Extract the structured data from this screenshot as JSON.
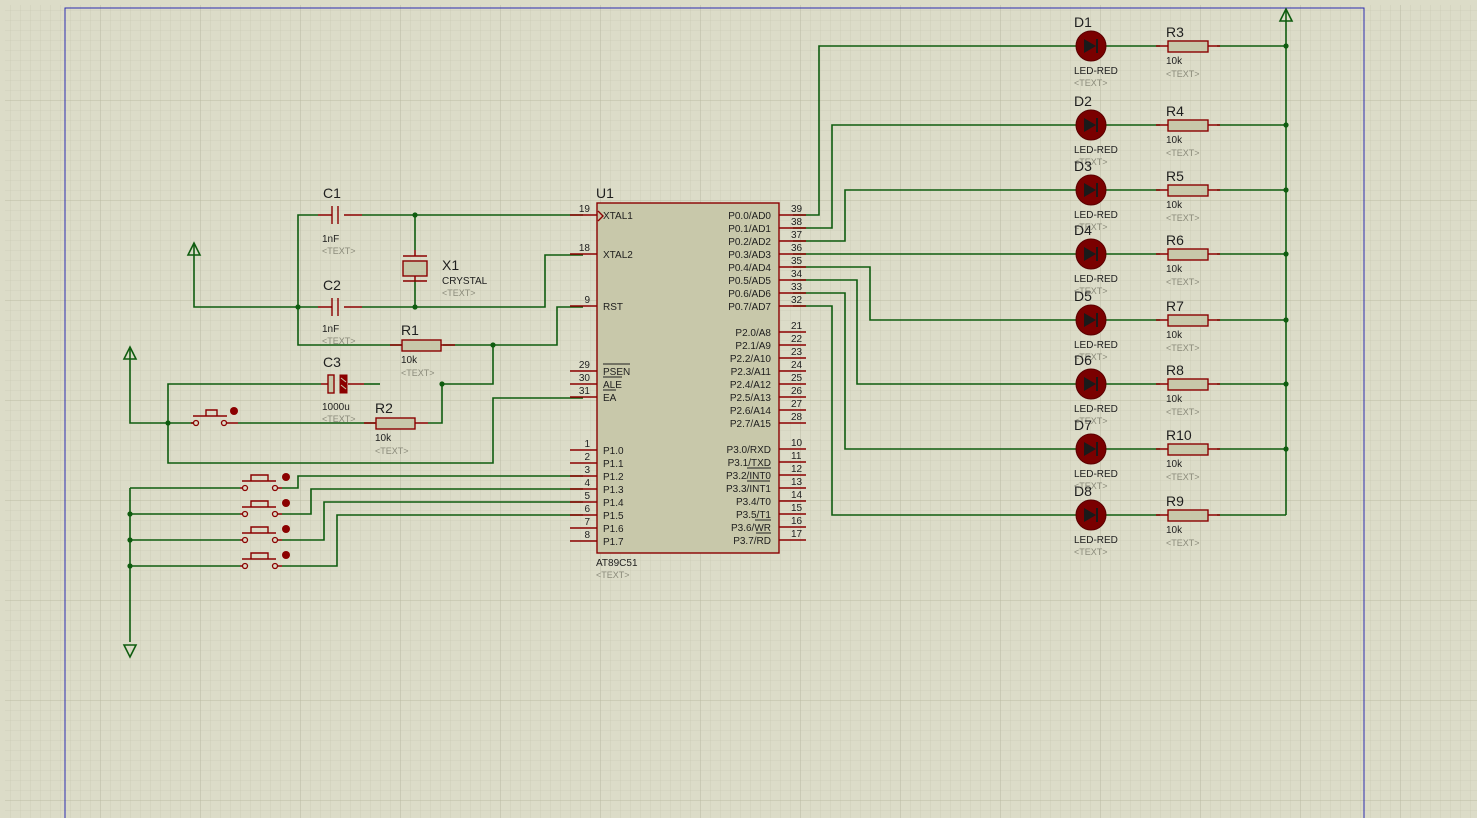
{
  "mcu": {
    "ref": "U1",
    "part": "AT89C51",
    "text": "<TEXT>",
    "left_pins": [
      {
        "num": "19",
        "name": "XTAL1"
      },
      {
        "num": "18",
        "name": "XTAL2"
      },
      {
        "num": "9",
        "name": "RST"
      },
      {
        "num": "29",
        "name": "PSEN"
      },
      {
        "num": "30",
        "name": "ALE"
      },
      {
        "num": "31",
        "name": "EA"
      },
      {
        "num": "1",
        "name": "P1.0"
      },
      {
        "num": "2",
        "name": "P1.1"
      },
      {
        "num": "3",
        "name": "P1.2"
      },
      {
        "num": "4",
        "name": "P1.3"
      },
      {
        "num": "5",
        "name": "P1.4"
      },
      {
        "num": "6",
        "name": "P1.5"
      },
      {
        "num": "7",
        "name": "P1.6"
      },
      {
        "num": "8",
        "name": "P1.7"
      }
    ],
    "right_pins": [
      {
        "num": "39",
        "name": "P0.0/AD0"
      },
      {
        "num": "38",
        "name": "P0.1/AD1"
      },
      {
        "num": "37",
        "name": "P0.2/AD2"
      },
      {
        "num": "36",
        "name": "P0.3/AD3"
      },
      {
        "num": "35",
        "name": "P0.4/AD4"
      },
      {
        "num": "34",
        "name": "P0.5/AD5"
      },
      {
        "num": "33",
        "name": "P0.6/AD6"
      },
      {
        "num": "32",
        "name": "P0.7/AD7"
      },
      {
        "num": "21",
        "name": "P2.0/A8"
      },
      {
        "num": "22",
        "name": "P2.1/A9"
      },
      {
        "num": "23",
        "name": "P2.2/A10"
      },
      {
        "num": "24",
        "name": "P2.3/A11"
      },
      {
        "num": "25",
        "name": "P2.4/A12"
      },
      {
        "num": "26",
        "name": "P2.5/A13"
      },
      {
        "num": "27",
        "name": "P2.6/A14"
      },
      {
        "num": "28",
        "name": "P2.7/A15"
      },
      {
        "num": "10",
        "name": "P3.0/RXD"
      },
      {
        "num": "11",
        "name": "P3.1/TXD"
      },
      {
        "num": "12",
        "name": "P3.2/INT0"
      },
      {
        "num": "13",
        "name": "P3.3/INT1"
      },
      {
        "num": "14",
        "name": "P3.4/T0"
      },
      {
        "num": "15",
        "name": "P3.5/T1"
      },
      {
        "num": "16",
        "name": "P3.6/WR"
      },
      {
        "num": "17",
        "name": "P3.7/RD"
      }
    ]
  },
  "components": {
    "c1": {
      "ref": "C1",
      "value": "1nF",
      "text": "<TEXT>"
    },
    "c2": {
      "ref": "C2",
      "value": "1nF",
      "text": "<TEXT>"
    },
    "c3": {
      "ref": "C3",
      "value": "1000u",
      "text": "<TEXT>"
    },
    "x1": {
      "ref": "X1",
      "value": "CRYSTAL",
      "text": "<TEXT>"
    },
    "r1": {
      "ref": "R1",
      "value": "10k",
      "text": "<TEXT>"
    },
    "r2": {
      "ref": "R2",
      "value": "10k",
      "text": "<TEXT>"
    }
  },
  "leds": [
    {
      "ref": "D1",
      "part": "LED-RED",
      "text": "<TEXT>",
      "res_ref": "R3",
      "res_value": "10k",
      "res_text": "<TEXT>"
    },
    {
      "ref": "D2",
      "part": "LED-RED",
      "text": "<TEXT>",
      "res_ref": "R4",
      "res_value": "10k",
      "res_text": "<TEXT>"
    },
    {
      "ref": "D3",
      "part": "LED-RED",
      "text": "<TEXT>",
      "res_ref": "R5",
      "res_value": "10k",
      "res_text": "<TEXT>"
    },
    {
      "ref": "D4",
      "part": "LED-RED",
      "text": "<TEXT>",
      "res_ref": "R6",
      "res_value": "10k",
      "res_text": "<TEXT>"
    },
    {
      "ref": "D5",
      "part": "LED-RED",
      "text": "<TEXT>",
      "res_ref": "R7",
      "res_value": "10k",
      "res_text": "<TEXT>"
    },
    {
      "ref": "D6",
      "part": "LED-RED",
      "text": "<TEXT>",
      "res_ref": "R8",
      "res_value": "10k",
      "res_text": "<TEXT>"
    },
    {
      "ref": "D7",
      "part": "LED-RED",
      "text": "<TEXT>",
      "res_ref": "R10",
      "res_value": "10k",
      "res_text": "<TEXT>"
    },
    {
      "ref": "D8",
      "part": "LED-RED",
      "text": "<TEXT>",
      "res_ref": "R9",
      "res_value": "10k",
      "res_text": "<TEXT>"
    }
  ],
  "colors": {
    "background": "#dcdcc8",
    "wire": "#0f5c0f",
    "component": "#8b0000",
    "sheet_border": "#2b2bb0"
  }
}
